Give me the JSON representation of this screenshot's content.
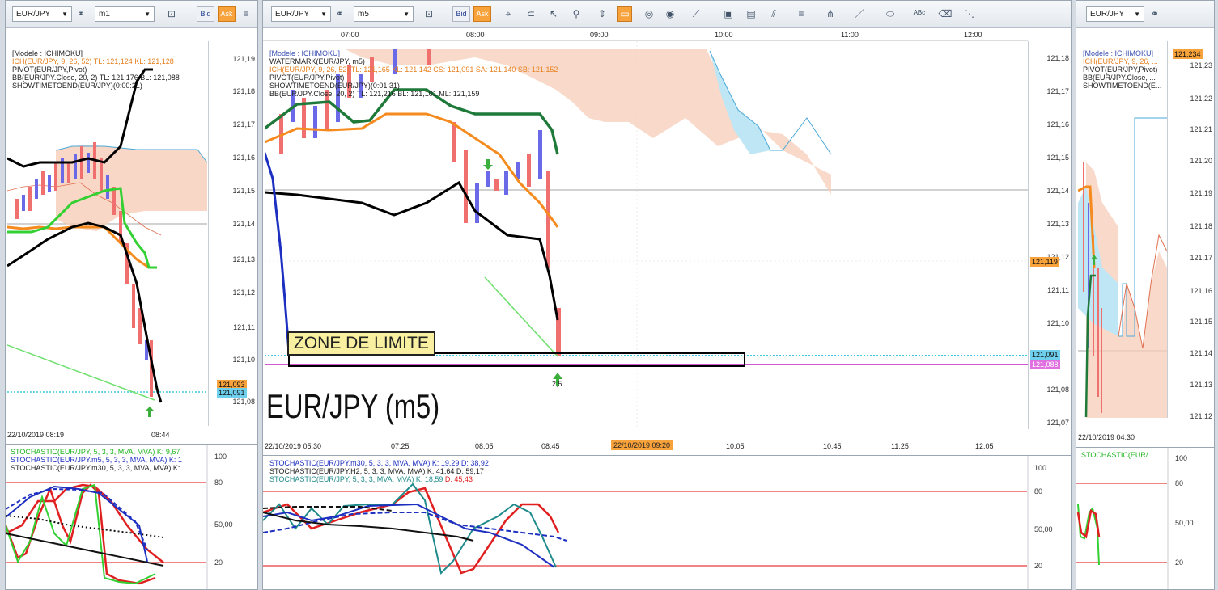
{
  "left": {
    "symbol": "EUR/JPY",
    "timeframe": "m1",
    "bid": "Bid",
    "ask": "Ask",
    "legend": [
      {
        "text": "[Modele : ICHIMOKU]",
        "color": "#3a4fb0"
      },
      {
        "text": "ICH(EUR/JPY, 9, 26, 52)  TL: 121,124  KL: 121,128",
        "color": "#e6801e"
      },
      {
        "text": "PIVOT(EUR/JPY,Pivot)",
        "color": "#111111"
      },
      {
        "text": "BB(EUR/JPY.Close, 20, 2)  TL: 121,176  BL: 121,088",
        "color": "#111111"
      },
      {
        "text": "SHOWTIMETOEND(EUR/JPY)(0:00:21)",
        "color": "#111111"
      }
    ],
    "yticks": [
      "121,19",
      "121,18",
      "121,17",
      "121,16",
      "121,15",
      "121,14",
      "121,13",
      "121,12",
      "121,11",
      "121,10",
      "121,09",
      "121,08"
    ],
    "tag_orange": "121,093",
    "tag_cyan": "121,091",
    "xlabels": [
      "22/10/2019 08:19",
      "08:44"
    ],
    "stoch_legend": [
      {
        "text": "STOCHASTIC(EUR/JPY, 5, 3, 3, MVA, MVA)  K: 9,67",
        "color": "#1fb51f"
      },
      {
        "text": "STOCHASTIC(EUR/JPY.m5, 5, 3, 3, MVA, MVA)  K: 1",
        "color": "#1c2fc0"
      },
      {
        "text": "STOCHASTIC(EUR/JPY.m30, 5, 3, 3, MVA, MVA)  K:",
        "color": "#111111"
      }
    ],
    "stoch_ticks": [
      "100",
      "80",
      "50,00",
      "20"
    ]
  },
  "center": {
    "symbol": "EUR/JPY",
    "timeframe": "m5",
    "bid": "Bid",
    "ask": "Ask",
    "top_times": [
      "07:00",
      "08:00",
      "09:00",
      "10:00",
      "11:00",
      "12:00"
    ],
    "legend": [
      {
        "text": "[Modele : ICHIMOKU]",
        "color": "#3a4fb0"
      },
      {
        "text": "WATERMARK(EUR/JPY, m5)",
        "color": "#111111"
      },
      {
        "text": "ICH(EUR/JPY, 9, 26, 52)  TL: 121,165  KL: 121,142   CS: 121,091   SA: 121,140   SB: 121,152",
        "color": "#e6801e"
      },
      {
        "text": "PIVOT(EUR/JPY,Pivot)",
        "color": "#111111"
      },
      {
        "text": "SHOWTIMETOEND(EUR/JPY)(0:01:31)",
        "color": "#111111"
      },
      {
        "text": "BB(EUR/JPY.Close, 20, 2)  TL: 121,216  BL: 121,101  ML: 121,159",
        "color": "#111111"
      }
    ],
    "yticks": [
      "121,18",
      "121,17",
      "121,16",
      "121,15",
      "121,14",
      "121,13",
      "121,12",
      "121,11",
      "121,10",
      "121,09",
      "121,08",
      "121,07"
    ],
    "tag_orange": "121,119",
    "tag_cyan": "121,091",
    "tag_magenta": "121,088",
    "zone_label": "ZONE DE LIMITE",
    "watermark": "EUR/JPY (m5)",
    "arrow_label": "2,5",
    "xlabels": [
      "22/10/2019 05:30",
      "07:25",
      "08:05",
      "08:45",
      "10:05",
      "10:45",
      "11:25",
      "12:05"
    ],
    "cursor_time": "22/10/2019 09:20",
    "stoch_legend": [
      {
        "text": "STOCHASTIC(EUR/JPY.m30, 5, 3, 3, MVA, MVA)  K: 19,29  D: 38,92",
        "color": "#1c2fc0"
      },
      {
        "text": "STOCHASTIC(EUR/JPY.H2, 5, 3, 3, MVA, MVA)  K: 41,64  D: 59,17",
        "color": "#111111"
      },
      {
        "text": "STOCHASTIC(EUR/JPY, 5, 3, 3, MVA, MVA)  K: 18,59",
        "color": "#1f8a8a"
      },
      {
        "text": "D: 45,43",
        "color": "#e02020"
      }
    ],
    "stoch_ticks": [
      "100",
      "80",
      "50,00",
      "20"
    ]
  },
  "right": {
    "symbol": "EUR/JPY",
    "legend": [
      {
        "text": "[Modele : ICHIMOKU]",
        "color": "#3a4fb0"
      },
      {
        "text": "ICH(EUR/JPY, 9, 26, ...",
        "color": "#e6801e"
      },
      {
        "text": "PIVOT(EUR/JPY,Pivot)",
        "color": "#111111"
      },
      {
        "text": "BB(EUR/JPY.Close, ...",
        "color": "#111111"
      },
      {
        "text": "SHOWTIMETOEND(E...",
        "color": "#111111"
      }
    ],
    "yticks": [
      "121,23",
      "121,22",
      "121,21",
      "121,20",
      "121,19",
      "121,18",
      "121,17",
      "121,16",
      "121,15",
      "121,14",
      "121,13",
      "121,12"
    ],
    "tag_orange": "121,234",
    "xlabels": [
      "22/10/2019 04:30"
    ],
    "stoch_legend": [
      {
        "text": "STOCHASTIC(EUR/...",
        "color": "#1fb51f"
      }
    ],
    "stoch_ticks": [
      "100",
      "80",
      "50,00",
      "20"
    ]
  }
}
